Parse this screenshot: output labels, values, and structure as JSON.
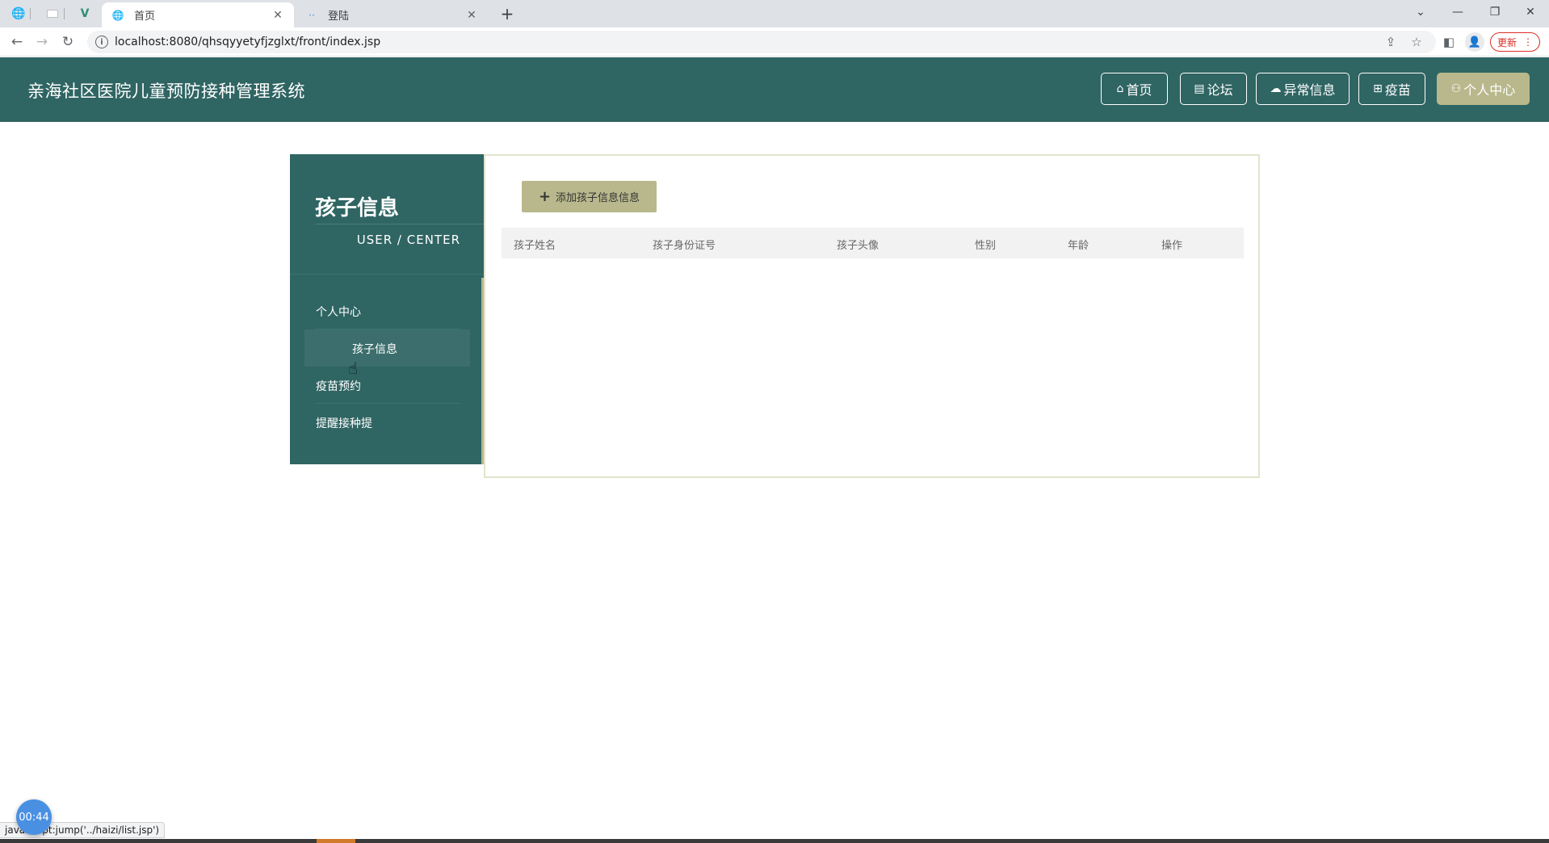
{
  "browser": {
    "tabs": [
      {
        "title": "首页",
        "active": true
      },
      {
        "title": "登陆",
        "active": false
      }
    ],
    "url": "localhost:8080/qhsqyyetyfjzglxt/front/index.jsp",
    "update_label": "更新"
  },
  "site": {
    "title": "亲海社区医院儿童预防接种管理系统",
    "nav": [
      {
        "label": "首页",
        "icon": "home-icon",
        "active": false
      },
      {
        "label": "论坛",
        "icon": "forum-icon",
        "active": false
      },
      {
        "label": "异常信息",
        "icon": "cloud-icon",
        "active": false
      },
      {
        "label": "疫苗",
        "icon": "grid-icon",
        "active": false
      },
      {
        "label": "个人中心",
        "icon": "user-icon",
        "active": true
      }
    ]
  },
  "sidebar": {
    "title": "孩子信息",
    "subtitle": "USER / CENTER",
    "items": [
      {
        "label": "个人中心"
      },
      {
        "label": "孩子信息",
        "active": true
      },
      {
        "label": "疫苗预约"
      },
      {
        "label": "提醒接种提"
      }
    ]
  },
  "main": {
    "add_button": "添加孩子信息信息",
    "columns": [
      "孩子姓名",
      "孩子身份证号",
      "孩子头像",
      "性别",
      "年龄",
      "操作"
    ],
    "rows": []
  },
  "overlay": {
    "status_text": "javascript:jump('../haizi/list.jsp')",
    "timer": "00:44"
  },
  "colors": {
    "primary": "#2f6563",
    "accent": "#b8b88c"
  }
}
